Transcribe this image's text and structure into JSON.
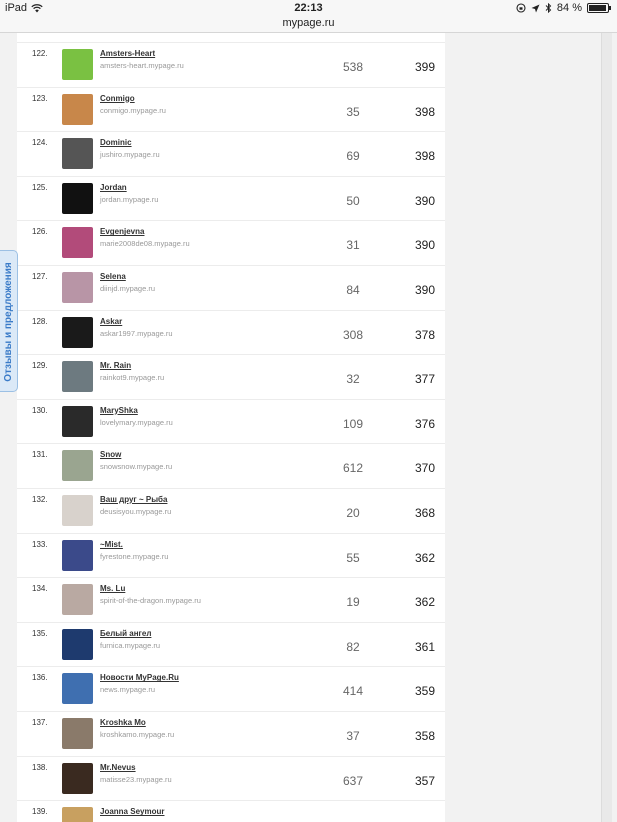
{
  "status_bar": {
    "device": "iPad",
    "time": "22:13",
    "battery": "84 %",
    "battery_level": 0.84
  },
  "browser": {
    "url": "mypage.ru"
  },
  "feedback_tab": {
    "label": "Отзывы и предложения"
  },
  "rows": [
    {
      "rank": "122.",
      "name": "Amsters-Heart",
      "site": "amsters-heart.mypage.ru",
      "value1": "538",
      "value2": "399",
      "avatar_color": "#7ac142"
    },
    {
      "rank": "123.",
      "name": "Conmigo",
      "site": "conmigo.mypage.ru",
      "value1": "35",
      "value2": "398",
      "avatar_color": "#c8874a"
    },
    {
      "rank": "124.",
      "name": "Dominic",
      "site": "jushiro.mypage.ru",
      "value1": "69",
      "value2": "398",
      "avatar_color": "#555555"
    },
    {
      "rank": "125.",
      "name": "Jordan",
      "site": "jordan.mypage.ru",
      "value1": "50",
      "value2": "390",
      "avatar_color": "#111111"
    },
    {
      "rank": "126.",
      "name": "Evgenjevna",
      "site": "marie2008de08.mypage.ru",
      "value1": "31",
      "value2": "390",
      "avatar_color": "#b24b7a"
    },
    {
      "rank": "127.",
      "name": "Selena",
      "site": "diinjd.mypage.ru",
      "value1": "84",
      "value2": "390",
      "avatar_color": "#b895a6"
    },
    {
      "rank": "128.",
      "name": "Askar",
      "site": "askar1997.mypage.ru",
      "value1": "308",
      "value2": "378",
      "avatar_color": "#1a1a1a"
    },
    {
      "rank": "129.",
      "name": "Mr. Rain",
      "site": "rainkot9.mypage.ru",
      "value1": "32",
      "value2": "377",
      "avatar_color": "#6d7a80"
    },
    {
      "rank": "130.",
      "name": "MaryShka",
      "site": "lovelymary.mypage.ru",
      "value1": "109",
      "value2": "376",
      "avatar_color": "#2a2a2a"
    },
    {
      "rank": "131.",
      "name": "Snow",
      "site": "snowsnow.mypage.ru",
      "value1": "612",
      "value2": "370",
      "avatar_color": "#9aa590"
    },
    {
      "rank": "132.",
      "name": "Ваш друг ~ Рыба",
      "site": "deusisyou.mypage.ru",
      "value1": "20",
      "value2": "368",
      "avatar_color": "#d8d2cc"
    },
    {
      "rank": "133.",
      "name": "~Mist.",
      "site": "fyrestone.mypage.ru",
      "value1": "55",
      "value2": "362",
      "avatar_color": "#3b4a8a"
    },
    {
      "rank": "134.",
      "name": "Ms. Lu",
      "site": "spirit-of-the-dragon.mypage.ru",
      "value1": "19",
      "value2": "362",
      "avatar_color": "#b9a9a2"
    },
    {
      "rank": "135.",
      "name": "Белый ангел",
      "site": "furnica.mypage.ru",
      "value1": "82",
      "value2": "361",
      "avatar_color": "#1e3a6e"
    },
    {
      "rank": "136.",
      "name": "Новости MyPage.Ru",
      "site": "news.mypage.ru",
      "value1": "414",
      "value2": "359",
      "avatar_color": "#3f6fb0"
    },
    {
      "rank": "137.",
      "name": "Kroshka Mo",
      "site": "kroshkamo.mypage.ru",
      "value1": "37",
      "value2": "358",
      "avatar_color": "#8a7a6a"
    },
    {
      "rank": "138.",
      "name": "Mr.Nevus",
      "site": "matisse23.mypage.ru",
      "value1": "637",
      "value2": "357",
      "avatar_color": "#3a2a20"
    },
    {
      "rank": "139.",
      "name": "Joanna Seymour",
      "site": "",
      "value1": "",
      "value2": "",
      "avatar_color": "#c8a060"
    }
  ]
}
